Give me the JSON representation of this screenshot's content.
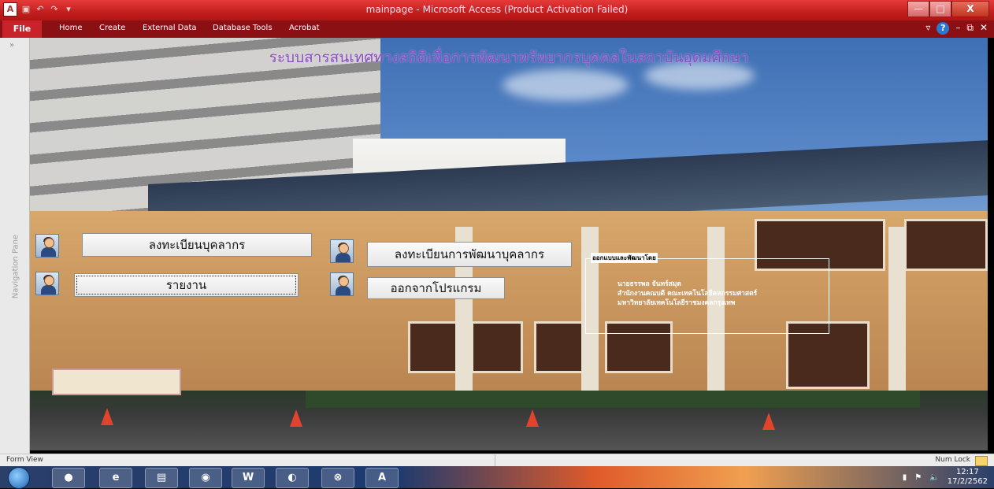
{
  "window": {
    "title": "mainpage - Microsoft Access (Product Activation Failed)",
    "app_icon": "A",
    "minimize": "—",
    "maximize": "□",
    "close": "X"
  },
  "ribbon": {
    "file_tab": "File",
    "tabs": [
      "Home",
      "Create",
      "External Data",
      "Database Tools",
      "Acrobat"
    ],
    "help": "?"
  },
  "nav_pane": {
    "label": "Navigation Pane",
    "expand": "»"
  },
  "form": {
    "title": "ระบบสารสนเทศทางสถิติเพื่อการพัฒนาทรัพยากรบุคคลในสถาบันอุดมศึกษา",
    "buttons": {
      "register_personnel": "ลงทะเบียนบุคลากร",
      "report": "รายงาน",
      "register_development": "ลงทะเบียนการพัฒนาบุคลากร",
      "exit": "ออกจากโปรแกรม"
    },
    "credit": {
      "caption": "ออกแบบและพัฒนาโดย",
      "lines": [
        "นายธรรพล จันทร์สมุด",
        "สำนักงานคณบดี คณะเทคโนโลยีคหกรรมศาสตร์",
        "มหาวิทยาลัยเทคโนโลยีราชมงคลกรุงเทพ"
      ]
    }
  },
  "statusbar": {
    "view": "Form View",
    "num_lock": "Num Lock"
  },
  "taskbar": {
    "apps": [
      "firefox-icon",
      "ie-icon",
      "explorer-icon",
      "chrome-icon",
      "word-icon",
      "media-icon",
      "sync-icon",
      "access-icon"
    ],
    "time": "12:17",
    "date": "17/2/2562"
  }
}
